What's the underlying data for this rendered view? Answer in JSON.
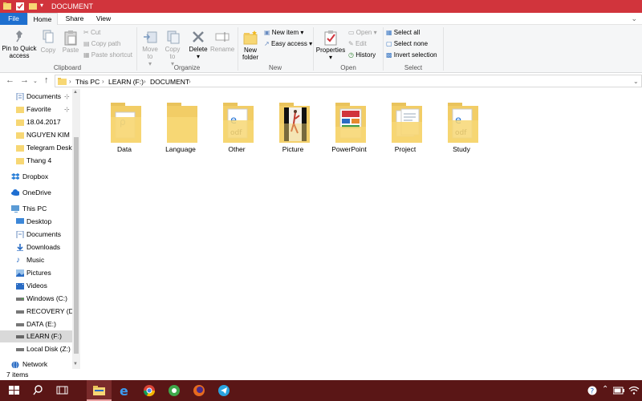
{
  "window": {
    "title": "DOCUMENT"
  },
  "ribbon_tabs": [
    {
      "label": "File"
    },
    {
      "label": "Home"
    },
    {
      "label": "Share"
    },
    {
      "label": "View"
    }
  ],
  "ribbon": {
    "clipboard": {
      "pin_label": "Pin to Quick access",
      "copy_label": "Copy",
      "paste_label": "Paste",
      "cut_label": "Cut",
      "copy_path_label": "Copy path",
      "paste_shortcut_label": "Paste shortcut",
      "group_label": "Clipboard"
    },
    "organize": {
      "move_to_label": "Move to",
      "copy_to_label": "Copy to",
      "delete_label": "Delete",
      "rename_label": "Rename",
      "group_label": "Organize"
    },
    "new": {
      "new_folder_label": "New folder",
      "new_item_label": "New item",
      "easy_access_label": "Easy access",
      "group_label": "New"
    },
    "open": {
      "properties_label": "Properties",
      "open_label": "Open",
      "edit_label": "Edit",
      "history_label": "History",
      "group_label": "Open"
    },
    "select": {
      "select_all_label": "Select all",
      "select_none_label": "Select none",
      "invert_selection_label": "Invert selection",
      "group_label": "Select"
    }
  },
  "address": {
    "crumbs": [
      "This PC",
      "LEARN (F:)",
      "DOCUMENT"
    ]
  },
  "nav_pane": {
    "quick_access": [
      {
        "label": "Documents",
        "pinned": true
      },
      {
        "label": "Favorite",
        "pinned": true
      },
      {
        "label": "18.04.2017"
      },
      {
        "label": "NGUYEN KIM"
      },
      {
        "label": "Telegram Desktop"
      },
      {
        "label": "Thang 4"
      }
    ],
    "dropbox": "Dropbox",
    "onedrive": "OneDrive",
    "this_pc": "This PC",
    "pc_items": [
      {
        "label": "Desktop",
        "icon": "desktop-icon"
      },
      {
        "label": "Documents",
        "icon": "documents-icon"
      },
      {
        "label": "Downloads",
        "icon": "downloads-icon"
      },
      {
        "label": "Music",
        "icon": "music-icon"
      },
      {
        "label": "Pictures",
        "icon": "pictures-icon"
      },
      {
        "label": "Videos",
        "icon": "videos-icon"
      },
      {
        "label": "Windows (C:)",
        "icon": "drive-icon"
      },
      {
        "label": "RECOVERY (D:)",
        "icon": "drive-icon"
      },
      {
        "label": "DATA (E:)",
        "icon": "drive-icon"
      },
      {
        "label": "LEARN (F:)",
        "icon": "drive-icon",
        "selected": true
      },
      {
        "label": "Local Disk (Z:)",
        "icon": "drive-icon"
      }
    ],
    "network": "Network"
  },
  "folders": [
    {
      "label": "Data",
      "preview": "pdf-doc"
    },
    {
      "label": "Language",
      "preview": "empty"
    },
    {
      "label": "Other",
      "preview": "edge-pdf"
    },
    {
      "label": "Picture",
      "preview": "photo"
    },
    {
      "label": "PowerPoint",
      "preview": "slides"
    },
    {
      "label": "Project",
      "preview": "docs"
    },
    {
      "label": "Study",
      "preview": "edge-pdf"
    }
  ],
  "status": {
    "item_count": "7 items"
  },
  "colors": {
    "titlebar": "#d1343c",
    "taskbar": "#5a1616",
    "file_tab": "#1e6fcf",
    "folder": "#f7d774"
  }
}
